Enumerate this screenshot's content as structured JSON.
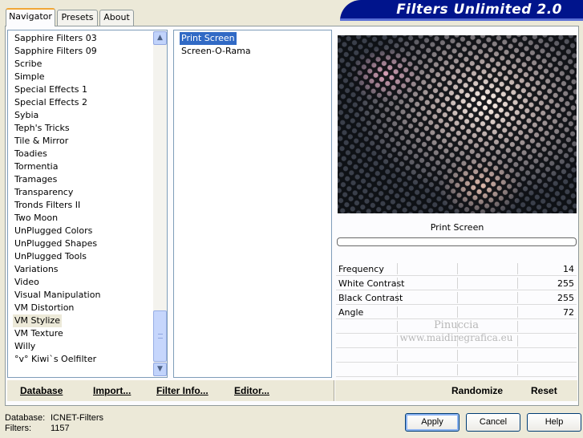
{
  "tabs": [
    {
      "label": "Navigator",
      "active": true
    },
    {
      "label": "Presets",
      "active": false
    },
    {
      "label": "About",
      "active": false
    }
  ],
  "banner": {
    "title": "Filters Unlimited 2.0"
  },
  "categories": {
    "items": [
      "Sapphire Filters 03",
      "Sapphire Filters 09",
      "Scribe",
      "Simple",
      "Special Effects 1",
      "Special Effects 2",
      "Sybia",
      "Teph's Tricks",
      "Tile & Mirror",
      "Toadies",
      "Tormentia",
      "Tramages",
      "Transparency",
      "Tronds Filters II",
      "Two Moon",
      "UnPlugged Colors",
      "UnPlugged Shapes",
      "UnPlugged Tools",
      "Variations",
      "Video",
      "Visual Manipulation",
      "VM Distortion",
      "VM Stylize",
      "VM Texture",
      "Willy",
      "°v° Kiwi`s Oelfilter"
    ],
    "selected_index": 22
  },
  "filters": {
    "items": [
      "Print Screen",
      "Screen-O-Rama"
    ],
    "selected_index": 0
  },
  "preview": {
    "filter_name": "Print Screen",
    "progress": 0
  },
  "params": [
    {
      "label": "Frequency",
      "value": "14"
    },
    {
      "label": "White Contrast",
      "value": "255"
    },
    {
      "label": "Black Contrast",
      "value": "255"
    },
    {
      "label": "Angle",
      "value": "72"
    }
  ],
  "watermark": {
    "line1": "Pinuccia",
    "line2": "www.maidiregrafica.eu"
  },
  "toolbar": {
    "database": "Database",
    "import": "Import...",
    "filter_info": "Filter Info...",
    "editor": "Editor...",
    "randomize": "Randomize",
    "reset": "Reset"
  },
  "footer": {
    "database_label": "Database:",
    "database_value": "ICNET-Filters",
    "filters_label": "Filters:",
    "filters_value": "1157"
  },
  "buttons": {
    "apply": "Apply",
    "cancel": "Cancel",
    "help": "Help"
  },
  "colors": {
    "banner": "#00148c",
    "selection": "#316ac5",
    "window": "#ece9d8"
  }
}
